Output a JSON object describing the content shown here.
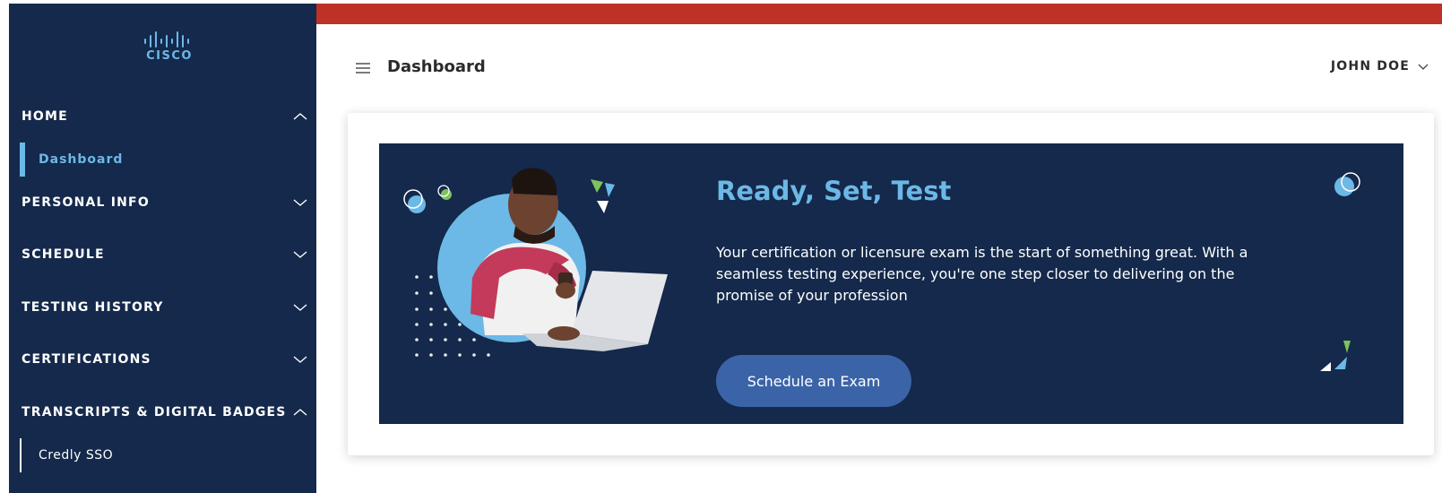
{
  "brand": {
    "logo_text": "CISCO"
  },
  "header": {
    "title": "Dashboard",
    "user_name": "JOHN DOE"
  },
  "sidebar": {
    "sections": [
      {
        "label": "HOME",
        "expanded": true
      },
      {
        "label": "PERSONAL INFO",
        "expanded": false
      },
      {
        "label": "SCHEDULE",
        "expanded": false
      },
      {
        "label": "TESTING HISTORY",
        "expanded": false
      },
      {
        "label": "CERTIFICATIONS",
        "expanded": false
      },
      {
        "label": "TRANSCRIPTS & DIGITAL BADGES",
        "expanded": true
      }
    ],
    "sub_items": [
      {
        "label": "Dashboard",
        "active": true
      },
      {
        "label": "Credly SSO",
        "active": false
      }
    ]
  },
  "banner": {
    "title": "Ready, Set, Test",
    "body": "Your certification or licensure exam is the start of something great. With a seamless testing experience, you're one step closer to delivering on the promise of your profession",
    "button_label": "Schedule an Exam"
  },
  "icons": {
    "hamburger": "menu-icon",
    "expand": "chevron-down-icon",
    "collapse": "chevron-up-icon",
    "user_menu": "chevron-down-icon"
  },
  "colors": {
    "sidebar_bg": "#14294b",
    "accent": "#6cb8e6",
    "top_bar": "#be3126",
    "button": "#3b64a8",
    "green_accent": "#7dc25b"
  }
}
